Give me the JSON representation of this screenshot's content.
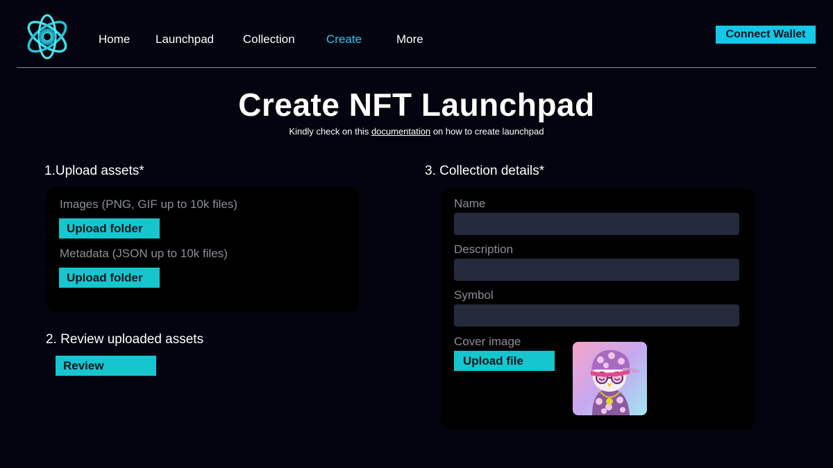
{
  "nav": {
    "items": [
      {
        "label": "Home"
      },
      {
        "label": "Launchpad"
      },
      {
        "label": "Collection"
      },
      {
        "label": "Create",
        "active": true
      },
      {
        "label": "More"
      }
    ],
    "connect_label": "Connect Wallet"
  },
  "header": {
    "title": "Create NFT Launchpad",
    "subtitle_before": "Kindly check on this ",
    "subtitle_link": "documentation",
    "subtitle_after": " on how to create launchpad"
  },
  "upload": {
    "heading": "1.Upload assets",
    "required_mark": "*",
    "images_label": "Images (PNG, GIF up to 10k files)",
    "images_button": "Upload folder",
    "metadata_label": "Metadata (JSON up to 10k files)",
    "metadata_button": "Upload folder"
  },
  "review": {
    "heading": "2. Review uploaded assets",
    "button": "Review"
  },
  "collection": {
    "heading": "3. Collection details",
    "required_mark": "*",
    "name_label": "Name",
    "name_value": "",
    "description_label": "Description",
    "description_value": "",
    "symbol_label": "Symbol",
    "symbol_value": "",
    "cover_label": "Cover image",
    "cover_button": "Upload file"
  },
  "colors": {
    "background": "#03040f",
    "accent": "#13c8ea",
    "active_nav": "#29c9f0",
    "panel": "#000000",
    "input": "#242a3b",
    "label": "#8b8f99"
  },
  "icons": {
    "logo": "atom-logo-icon",
    "cover": "nft-cover-thumbnail"
  }
}
